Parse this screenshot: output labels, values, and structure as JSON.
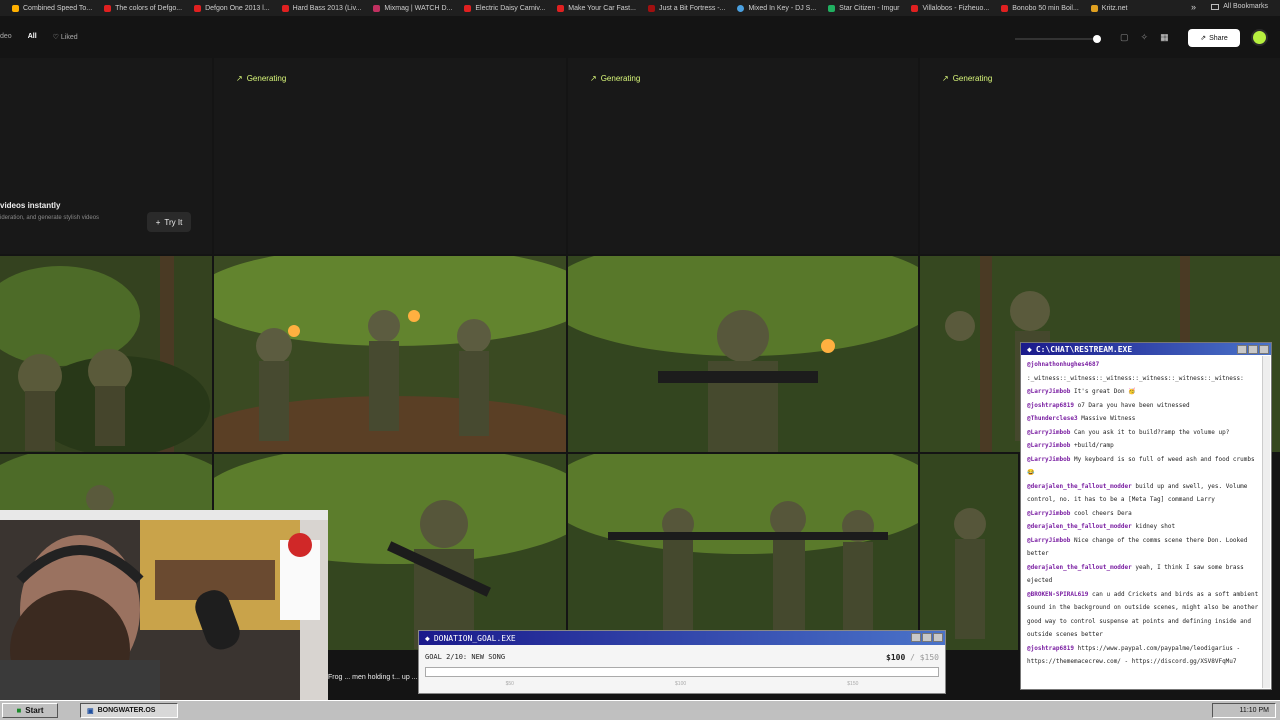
{
  "bookmarks": {
    "items": [
      "Combined Speed To...",
      "The colors of Defgo...",
      "Defgon One 2013 l...",
      "Hard Bass 2013 (Liv...",
      "Mixmag | WATCH D...",
      "Electric Daisy Carniv...",
      "Make Your Car Fast...",
      "Just a Bit Fortress -...",
      "Mixed In Key - DJ S...",
      "Star Citizen - Imgur",
      "Villalobos - Fizheuo...",
      "Bonobo 50 min Boil...",
      "Kritz.net"
    ],
    "more": "»",
    "all_bookmarks": "All Bookmarks"
  },
  "toolbar": {
    "video_tab": "deo",
    "all_tab": "All",
    "liked_tab": "Liked",
    "share_label": "Share"
  },
  "generating": {
    "label": "Generating"
  },
  "promo": {
    "title": "videos instantly",
    "subtitle": "ideration, and generate stylish videos",
    "try_label": "Try It"
  },
  "donation": {
    "title": "DONATION_GOAL.EXE",
    "goal_text": "GOAL 2/10: NEW SONG",
    "current": "$100",
    "target": "/ $150",
    "progress_fraction": 0.0,
    "ticks": [
      "$50",
      "$100",
      "$150"
    ]
  },
  "chat": {
    "title": "C:\\CHAT\\RESTREAM.EXE",
    "messages": [
      {
        "user": "@johnathonhughes4687",
        "text": ""
      },
      {
        "user": "",
        "text": ":_witness::_witness::_witness::_witness::_witness::_witness:"
      },
      {
        "user": "@LarryJimbob",
        "text": "It's great Don 🥳"
      },
      {
        "user": "@joshtrap6819",
        "text": "o7 Dara you have been witnessed"
      },
      {
        "user": "@Thunderclese3",
        "text": "Massive Witness"
      },
      {
        "user": "@LarryJimbob",
        "text": "Can you ask it to build?ramp the volume up?"
      },
      {
        "user": "@LarryJimbob",
        "text": "+build/ramp"
      },
      {
        "user": "@LarryJimbob",
        "text": "My keyboard is so full of weed ash and food crumbs 😂"
      },
      {
        "user": "@derajalen_the_fallout_modder",
        "text": "build up and swell, yes. Volume control, no. it has to be a [Meta Tag] command Larry"
      },
      {
        "user": "@LarryJimbob",
        "text": "cool cheers Dera"
      },
      {
        "user": "@derajalen_the_fallout_modder",
        "text": "kidney shot"
      },
      {
        "user": "@LarryJimbob",
        "text": "Nice change of the comms scene there Don. Looked better"
      },
      {
        "user": "@derajalen_the_fallout_modder",
        "text": "yeah, I think I saw some brass ejected"
      },
      {
        "user": "@BROKEN-SPIRAL619",
        "text": "can u add Crickets and birds as a soft ambient sound in the background on outside scenes, might also be another good way to control suspense at points and defining inside and outside scenes better"
      },
      {
        "user": "@joshtrap6819",
        "text": "https://www.paypal.com/paypalme/leodigarius - https://thememacecrew.com/ - https://discord.gg/XSV8VFqMu7"
      }
    ]
  },
  "caption": {
    "text": "Frog ... men holding t... up ... as the group is"
  },
  "taskbar": {
    "start_label": "Start",
    "window_label": "BONGWATER.OS",
    "clock": "11:10 PM"
  },
  "colors": {
    "accent": "#d9f77a",
    "avatar": "#b7f03f",
    "title_bar_start": "#1b1a8c",
    "title_bar_end": "#4a73c9"
  }
}
